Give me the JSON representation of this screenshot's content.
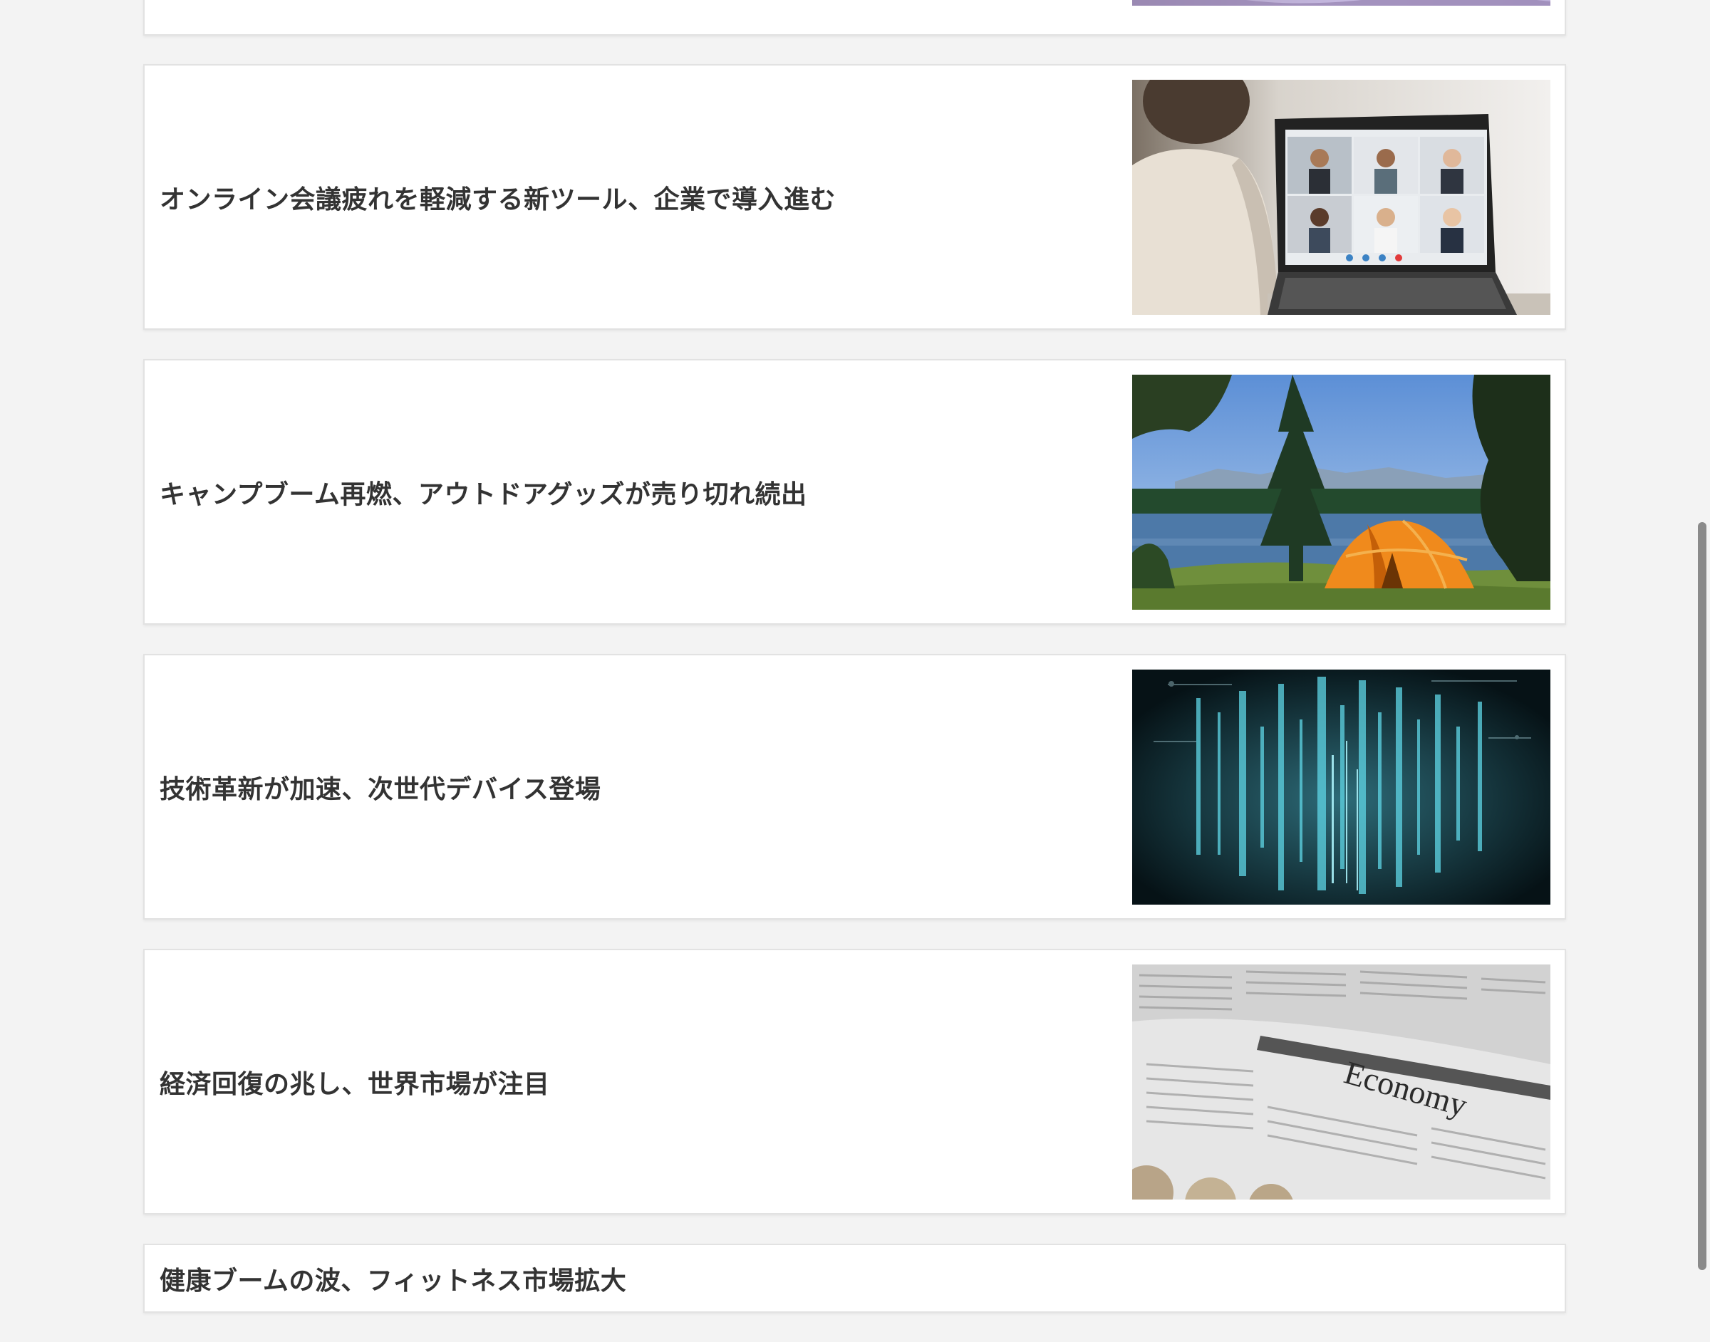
{
  "articles": [
    {
      "title": "",
      "image": "lake-photo"
    },
    {
      "title": "オンライン会議疲れを軽減する新ツール、企業で導入進む",
      "image": "video-call-laptop-photo"
    },
    {
      "title": "キャンプブーム再燃、アウトドアグッズが売り切れ続出",
      "image": "camping-tent-photo"
    },
    {
      "title": "技術革新が加速、次世代デバイス登場",
      "image": "digital-data-photo"
    },
    {
      "title": "経済回復の兆し、世界市場が注目",
      "image": "economy-newspaper-photo",
      "image_text": "Economy"
    },
    {
      "title": "健康ブームの波、フィットネス市場拡大"
    }
  ],
  "colors": {
    "background": "#f3f3f3",
    "card": "#ffffff",
    "title_text": "#333333",
    "scrollbar": "#8a8a8a"
  }
}
